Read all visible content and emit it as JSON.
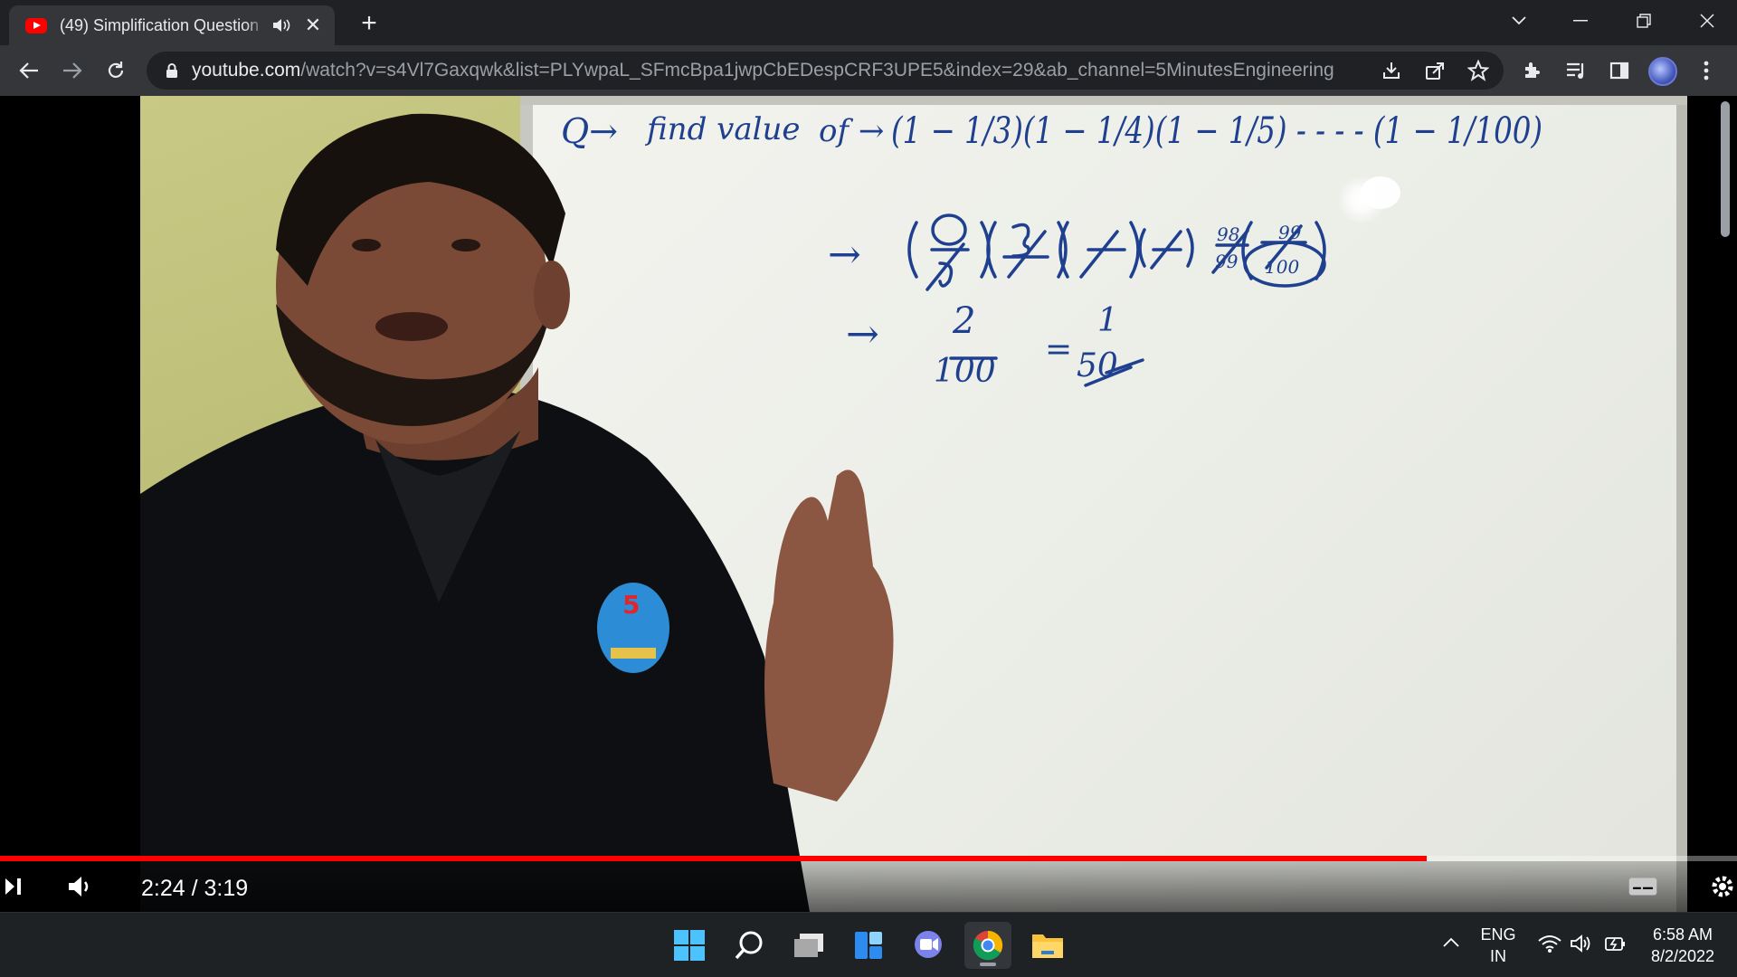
{
  "browser": {
    "tab": {
      "title": "(49) Simplification Question",
      "close_glyph": "✕",
      "favicon": "youtube-icon"
    },
    "new_tab_glyph": "+",
    "url_host": "youtube.com",
    "url_path": "/watch?v=s4Vl7Gaxqwk&list=PLYwpaL_SFmcBpa1jwpCbEDespCRF3UPE5&index=29&ab_channel=5MinutesEngineering",
    "accent_color": "#ff0000"
  },
  "whiteboard": {
    "line1_prefix": "Q→",
    "line1_text": "find value",
    "line1_of": "of →",
    "line1_expr": "(1 − 1/3)(1 − 1/4)(1 − 1/5) - - - - (1 − 1/100)",
    "line2_arrow": "→",
    "line3_arrow": "→",
    "result_num": "2",
    "result_den": "100",
    "equals": "=",
    "final_num": "1",
    "final_den": "50",
    "logo_digit": "5"
  },
  "player": {
    "current_time": "2:24",
    "duration": "3:19",
    "time_display": "2:24 / 3:19",
    "progress_fraction": 0.8211
  },
  "taskbar": {
    "lang_line1": "ENG",
    "lang_line2": "IN",
    "clock_time": "6:58 AM",
    "clock_date": "8/2/2022",
    "apps": [
      "windows-start-icon",
      "search-icon",
      "task-view-icon",
      "widgets-icon",
      "teams-chat-icon",
      "chrome-icon",
      "file-explorer-icon"
    ]
  }
}
